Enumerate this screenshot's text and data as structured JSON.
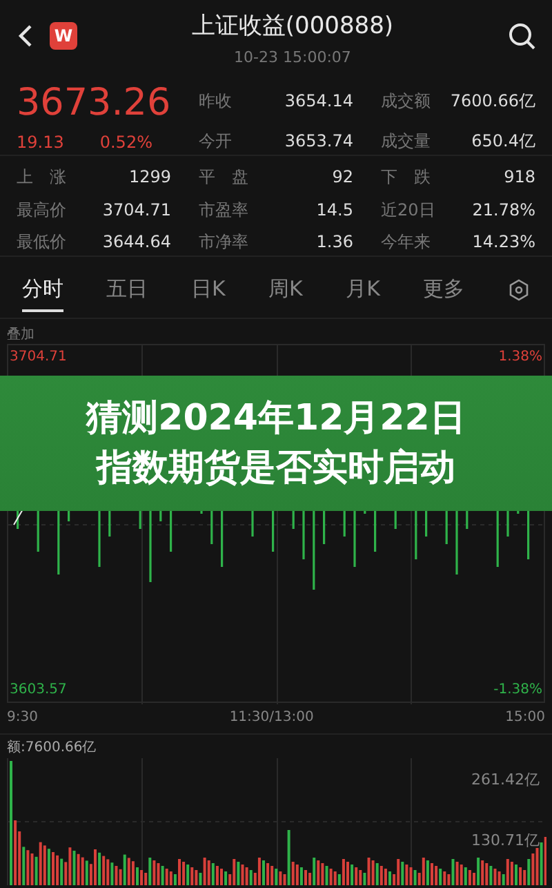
{
  "header": {
    "title": "上证收益(000888)",
    "time": "10-23 15:00:07",
    "logo": "W"
  },
  "quote": {
    "price": "3673.26",
    "change": "19.13",
    "percent": "0.52%",
    "rising": true
  },
  "quote_stats": [
    {
      "label": "昨收",
      "value": "3654.14"
    },
    {
      "label": "成交额",
      "value": "7600.66亿"
    },
    {
      "label": "今开",
      "value": "3653.74"
    },
    {
      "label": "成交量",
      "value": "650.4亿"
    }
  ],
  "stats": [
    {
      "label": "上　涨",
      "value": "1299"
    },
    {
      "label": "平　盘",
      "value": "92"
    },
    {
      "label": "下　跌",
      "value": "918"
    },
    {
      "label": "最高价",
      "value": "3704.71"
    },
    {
      "label": "市盈率",
      "value": "14.5"
    },
    {
      "label": "近20日",
      "value": "21.78%"
    },
    {
      "label": "最低价",
      "value": "3644.64"
    },
    {
      "label": "市净率",
      "value": "1.36"
    },
    {
      "label": "今年来",
      "value": "14.23%"
    }
  ],
  "tabs": [
    {
      "label": "分时",
      "selected": true
    },
    {
      "label": "五日",
      "selected": false
    },
    {
      "label": "日K",
      "selected": false
    },
    {
      "label": "周K",
      "selected": false
    },
    {
      "label": "月K",
      "selected": false
    },
    {
      "label": "更多",
      "selected": false
    }
  ],
  "chart": {
    "overlay_label": "叠加",
    "high": "3704.71",
    "high_pct": "1.38%",
    "low": "3603.57",
    "low_pct": "-1.38%",
    "times": [
      "9:30",
      "11:30/13:00",
      "15:00"
    ]
  },
  "volume": {
    "label": "额:7600.66亿",
    "max": "261.42亿",
    "mid": "130.71亿"
  },
  "banner": {
    "lines": [
      "猜测2024年12月22日",
      "指数期货是否实时启动"
    ]
  }
}
